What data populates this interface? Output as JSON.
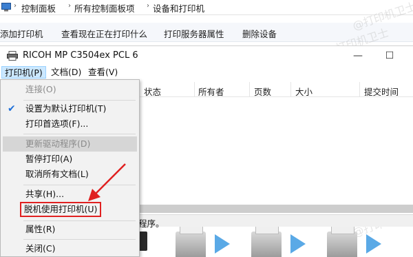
{
  "breadcrumb": {
    "items": [
      "控制面板",
      "所有控制面板项",
      "设备和打印机"
    ],
    "separator": "›"
  },
  "commands": [
    "添加打印机",
    "查看现在正在打印什么",
    "打印服务器属性",
    "删除设备"
  ],
  "window": {
    "title": "RICOH MP C3504ex PCL 6",
    "minimize_glyph": "—",
    "maximize_glyph": "☐",
    "menu": [
      "打印机(P)",
      "文档(D)",
      "查看(V)"
    ]
  },
  "columns": [
    "状态",
    "所有者",
    "页数",
    "大小",
    "提交时间"
  ],
  "status_text": "程序。",
  "dropdown": {
    "items": [
      {
        "label": "连接(O)",
        "disabled": true
      },
      {
        "label": "设置为默认打印机(T)",
        "checked": true
      },
      {
        "label": "打印首选项(F)..."
      },
      {
        "label": "更新驱动程序(D)",
        "disabled": true
      },
      {
        "label": "暂停打印(A)"
      },
      {
        "label": "取消所有文档(L)"
      },
      {
        "label": "共享(H)..."
      },
      {
        "label": "脱机使用打印机(U)",
        "highlighted": true
      },
      {
        "label": "属性(R)"
      },
      {
        "label": "关闭(C)"
      }
    ]
  },
  "watermark": "@打印机卫士",
  "colors": {
    "annotation": "#e02020",
    "accent_blue": "#1e6fd9",
    "menu_active": "#cce8ff"
  }
}
